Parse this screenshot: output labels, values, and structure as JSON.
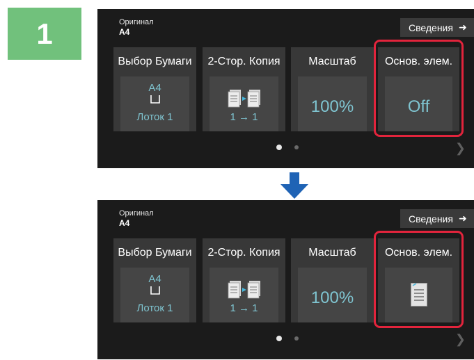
{
  "step": {
    "number": "1"
  },
  "panels": [
    {
      "original_label": "Оригинал",
      "original_value": "A4",
      "details_button": "Сведения",
      "details_arrow": "➜",
      "tiles": {
        "paper": {
          "title": "Выбор Бумаги",
          "size": "A4",
          "tray": "Лоток 1"
        },
        "duplex": {
          "title": "2-Стор. Копия",
          "mode": "1 → 1"
        },
        "scale": {
          "title": "Масштаб",
          "value": "100%"
        },
        "basic": {
          "title": "Основ. элем.",
          "value": "Off"
        }
      },
      "page_indicator": {
        "current": 1,
        "total": 2
      }
    },
    {
      "original_label": "Оригинал",
      "original_value": "A4",
      "details_button": "Сведения",
      "details_arrow": "➜",
      "tiles": {
        "paper": {
          "title": "Выбор Бумаги",
          "size": "A4",
          "tray": "Лоток 1"
        },
        "duplex": {
          "title": "2-Стор. Копия",
          "mode": "1 → 1"
        },
        "scale": {
          "title": "Масштаб",
          "value": "100%"
        },
        "basic": {
          "title": "Основ. элем.",
          "icon": "document-icon"
        }
      },
      "page_indicator": {
        "current": 1,
        "total": 2
      }
    }
  ],
  "colors": {
    "step_badge": "#71c17c",
    "panel_bg": "#1b1b1b",
    "tile_bg": "#383838",
    "value_text": "#7fc4d0",
    "highlight": "#e2243c",
    "arrow": "#1f63b5"
  }
}
